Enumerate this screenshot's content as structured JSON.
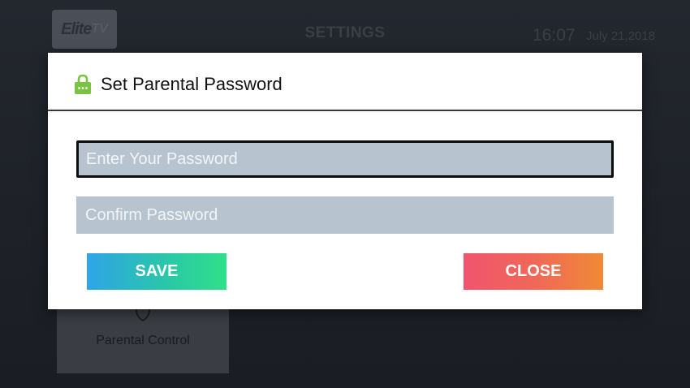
{
  "background": {
    "logo_text": "Elite",
    "logo_suffix": "TV",
    "title": "SETTINGS",
    "time": "16:07",
    "date": "July 21,2018",
    "tile_label": "Parental Control"
  },
  "dialog": {
    "title": "Set Parental Password",
    "password_placeholder": "Enter Your Password",
    "confirm_placeholder": "Confirm Password",
    "save_label": "SAVE",
    "close_label": "CLOSE"
  },
  "colors": {
    "lock_icon": "#7cc242",
    "field_bg": "#b7c3cf",
    "save_gradient": [
      "#2fa4e7",
      "#30e08a"
    ],
    "close_gradient": [
      "#f0546f",
      "#ef8a35"
    ]
  },
  "icons": [
    "lock-icon",
    "shield-icon"
  ]
}
